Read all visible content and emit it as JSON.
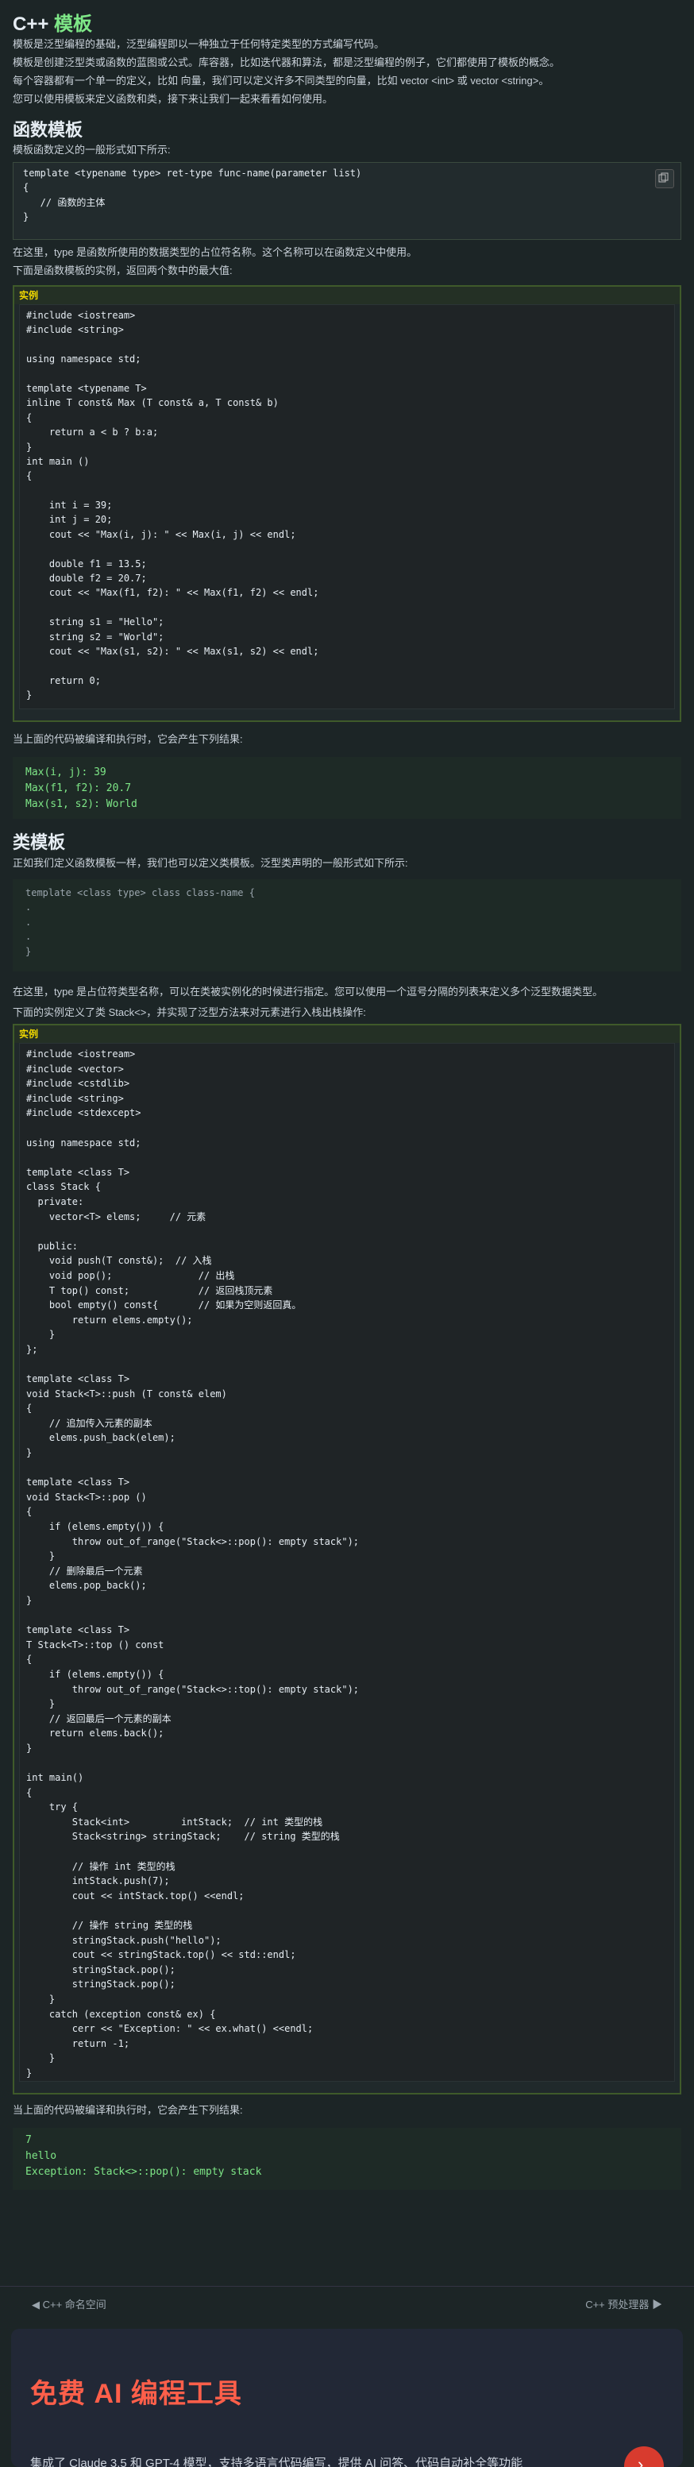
{
  "header": {
    "title_prefix": "C++ ",
    "title_accent": "模板"
  },
  "intro": [
    "模板是泛型编程的基础，泛型编程即以一种独立于任何特定类型的方式编写代码。",
    "模板是创建泛型类或函数的蓝图或公式。库容器，比如迭代器和算法，都是泛型编程的例子，它们都使用了模板的概念。",
    "每个容器都有一个单一的定义，比如 向量，我们可以定义许多不同类型的向量，比如 vector <int> 或 vector <string>。",
    "您可以使用模板来定义函数和类，接下来让我们一起来看看如何使用。"
  ],
  "func_section": {
    "heading": "函数模板",
    "desc": "模板函数定义的一般形式如下所示:",
    "syntax": [
      "template <typename type> ret-type func-name(parameter list)",
      "{",
      "   // 函数的主体",
      "}"
    ],
    "after1": "在这里，type 是函数所使用的数据类型的占位符名称。这个名称可以在函数定义中使用。",
    "after2": "下面是函数模板的实例，返回两个数中的最大值:",
    "example_label": "实例",
    "example_code": [
      "#include <iostream>",
      "#include <string>",
      "",
      "using namespace std;",
      "",
      "template <typename T>",
      "inline T const& Max (T const& a, T const& b)",
      "{",
      "    return a < b ? b:a;",
      "}",
      "int main ()",
      "{",
      "",
      "    int i = 39;",
      "    int j = 20;",
      "    cout << \"Max(i, j): \" << Max(i, j) << endl;",
      "",
      "    double f1 = 13.5;",
      "    double f2 = 20.7;",
      "    cout << \"Max(f1, f2): \" << Max(f1, f2) << endl;",
      "",
      "    string s1 = \"Hello\";",
      "    string s2 = \"World\";",
      "    cout << \"Max(s1, s2): \" << Max(s1, s2) << endl;",
      "",
      "    return 0;",
      "}"
    ],
    "result_desc": "当上面的代码被编译和执行时，它会产生下列结果:",
    "output": [
      "Max(i, j): 39",
      "Max(f1, f2): 20.7",
      "Max(s1, s2): World"
    ]
  },
  "class_section": {
    "heading": "类模板",
    "desc": "正如我们定义函数模板一样，我们也可以定义类模板。泛型类声明的一般形式如下所示:",
    "syntax": [
      "template <class type> class class-name {",
      ".",
      ".",
      ".",
      "}"
    ],
    "after1": "在这里，type 是占位符类型名称，可以在类被实例化的时候进行指定。您可以使用一个逗号分隔的列表来定义多个泛型数据类型。",
    "after2": "下面的实例定义了类 Stack<>，并实现了泛型方法来对元素进行入栈出栈操作:",
    "example_label": "实例",
    "example_code": [
      "#include <iostream>",
      "#include <vector>",
      "#include <cstdlib>",
      "#include <string>",
      "#include <stdexcept>",
      "",
      "using namespace std;",
      "",
      "template <class T>",
      "class Stack {",
      "  private:",
      "    vector<T> elems;     // 元素",
      "",
      "  public:",
      "    void push(T const&);  // 入栈",
      "    void pop();               // 出栈",
      "    T top() const;            // 返回栈顶元素",
      "    bool empty() const{       // 如果为空则返回真。",
      "        return elems.empty();",
      "    }",
      "};",
      "",
      "template <class T>",
      "void Stack<T>::push (T const& elem)",
      "{",
      "    // 追加传入元素的副本",
      "    elems.push_back(elem);",
      "}",
      "",
      "template <class T>",
      "void Stack<T>::pop ()",
      "{",
      "    if (elems.empty()) {",
      "        throw out_of_range(\"Stack<>::pop(): empty stack\");",
      "    }",
      "    // 删除最后一个元素",
      "    elems.pop_back();",
      "}",
      "",
      "template <class T>",
      "T Stack<T>::top () const",
      "{",
      "    if (elems.empty()) {",
      "        throw out_of_range(\"Stack<>::top(): empty stack\");",
      "    }",
      "    // 返回最后一个元素的副本",
      "    return elems.back();",
      "}",
      "",
      "int main()",
      "{",
      "    try {",
      "        Stack<int>         intStack;  // int 类型的栈",
      "        Stack<string> stringStack;    // string 类型的栈",
      "",
      "        // 操作 int 类型的栈",
      "        intStack.push(7);",
      "        cout << intStack.top() <<endl;",
      "",
      "        // 操作 string 类型的栈",
      "        stringStack.push(\"hello\");",
      "        cout << stringStack.top() << std::endl;",
      "        stringStack.pop();",
      "        stringStack.pop();",
      "    }",
      "    catch (exception const& ex) {",
      "        cerr << \"Exception: \" << ex.what() <<endl;",
      "        return -1;",
      "    }",
      "}"
    ],
    "result_desc": "当上面的代码被编译和执行时，它会产生下列结果:",
    "output": [
      "7",
      "hello",
      "Exception: Stack<>::pop(): empty stack"
    ]
  },
  "nav": {
    "prev": "C++ 命名空间",
    "next": "C++ 预处理器"
  },
  "promo": {
    "title": "免费 AI 编程工具",
    "desc": "集成了 Claude 3.5 和 GPT-4 模型，支持多语言代码编写，提供 AI 问答、代码自动补全等功能"
  },
  "icons": {
    "copy": "copy-icon",
    "prev": "arrow-left-icon",
    "next": "arrow-right-icon"
  }
}
